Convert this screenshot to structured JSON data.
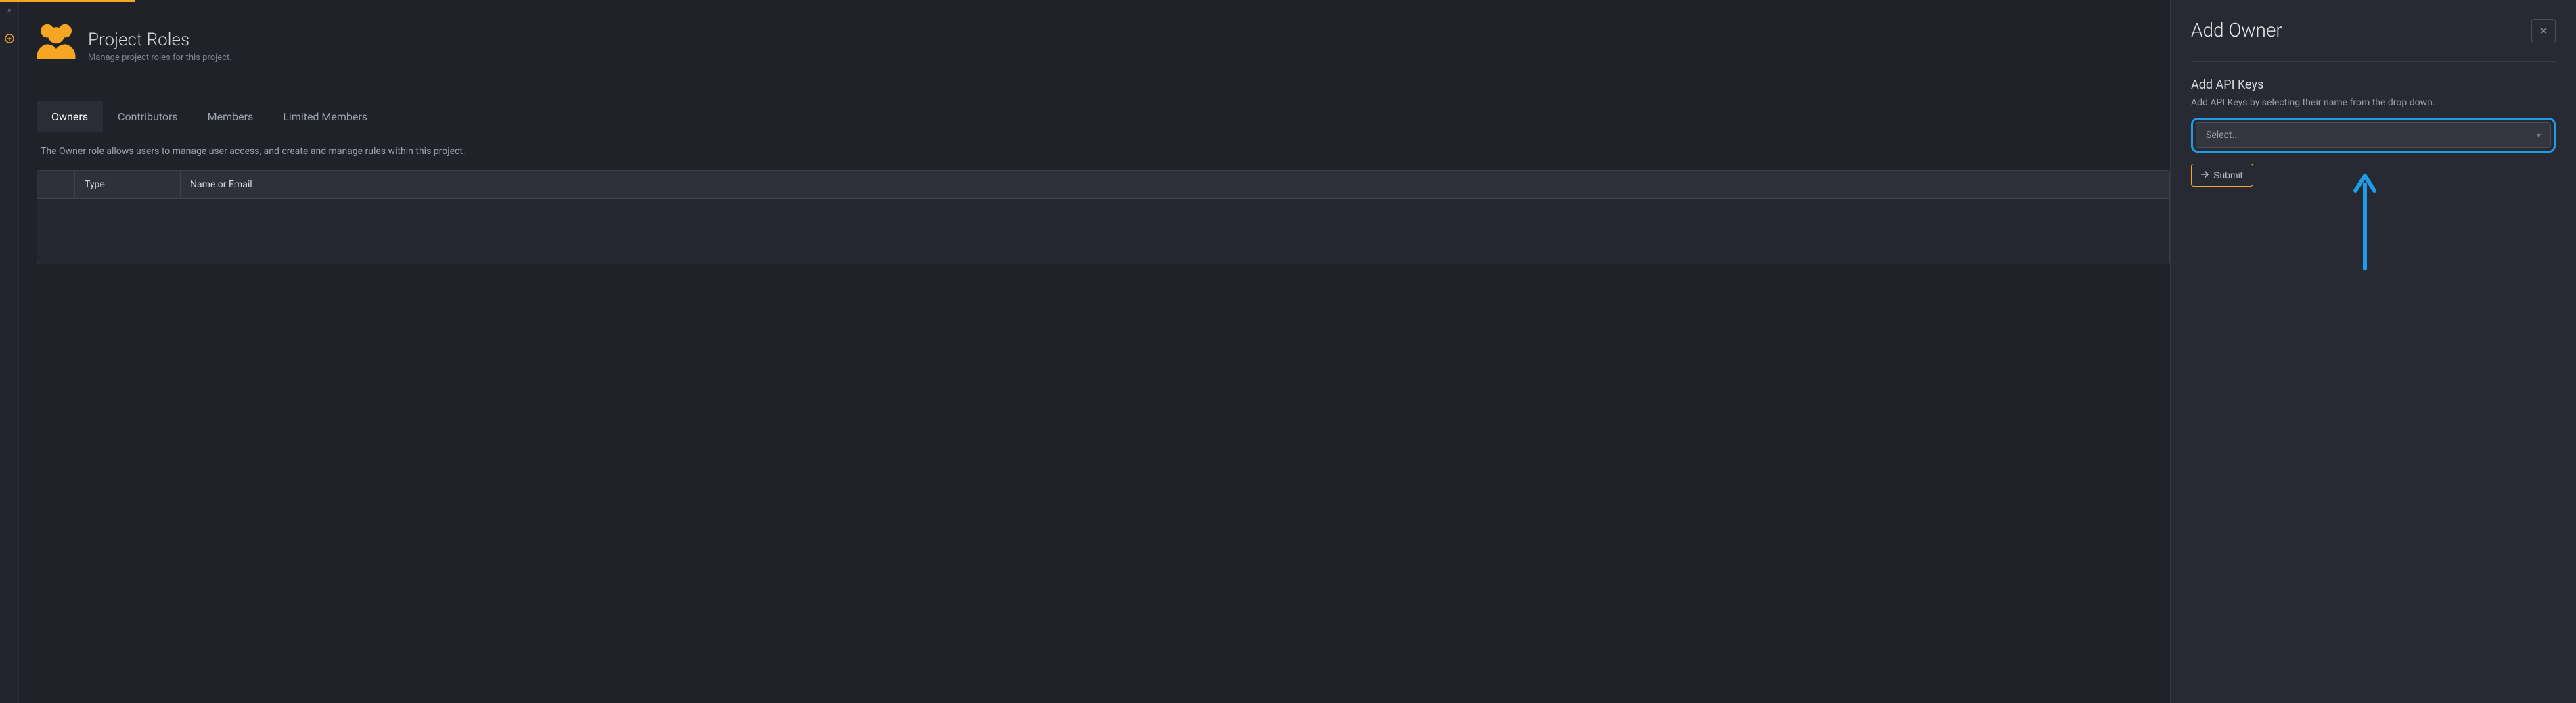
{
  "page": {
    "title": "Project Roles",
    "subtitle": "Manage project roles for this project."
  },
  "tabs": {
    "items": [
      {
        "label": "Owners",
        "active": true
      },
      {
        "label": "Contributors",
        "active": false
      },
      {
        "label": "Members",
        "active": false
      },
      {
        "label": "Limited Members",
        "active": false
      }
    ],
    "description": "The Owner role allows users to manage user access, and create and manage rules within this project."
  },
  "table": {
    "columns": {
      "type": "Type",
      "name_or_email": "Name or Email"
    },
    "rows": []
  },
  "panel": {
    "title": "Add Owner",
    "section": {
      "heading": "Add API Keys",
      "hint": "Add API Keys by selecting their name from the drop down.",
      "select_placeholder": "Select..."
    },
    "submit_label": "Submit"
  }
}
